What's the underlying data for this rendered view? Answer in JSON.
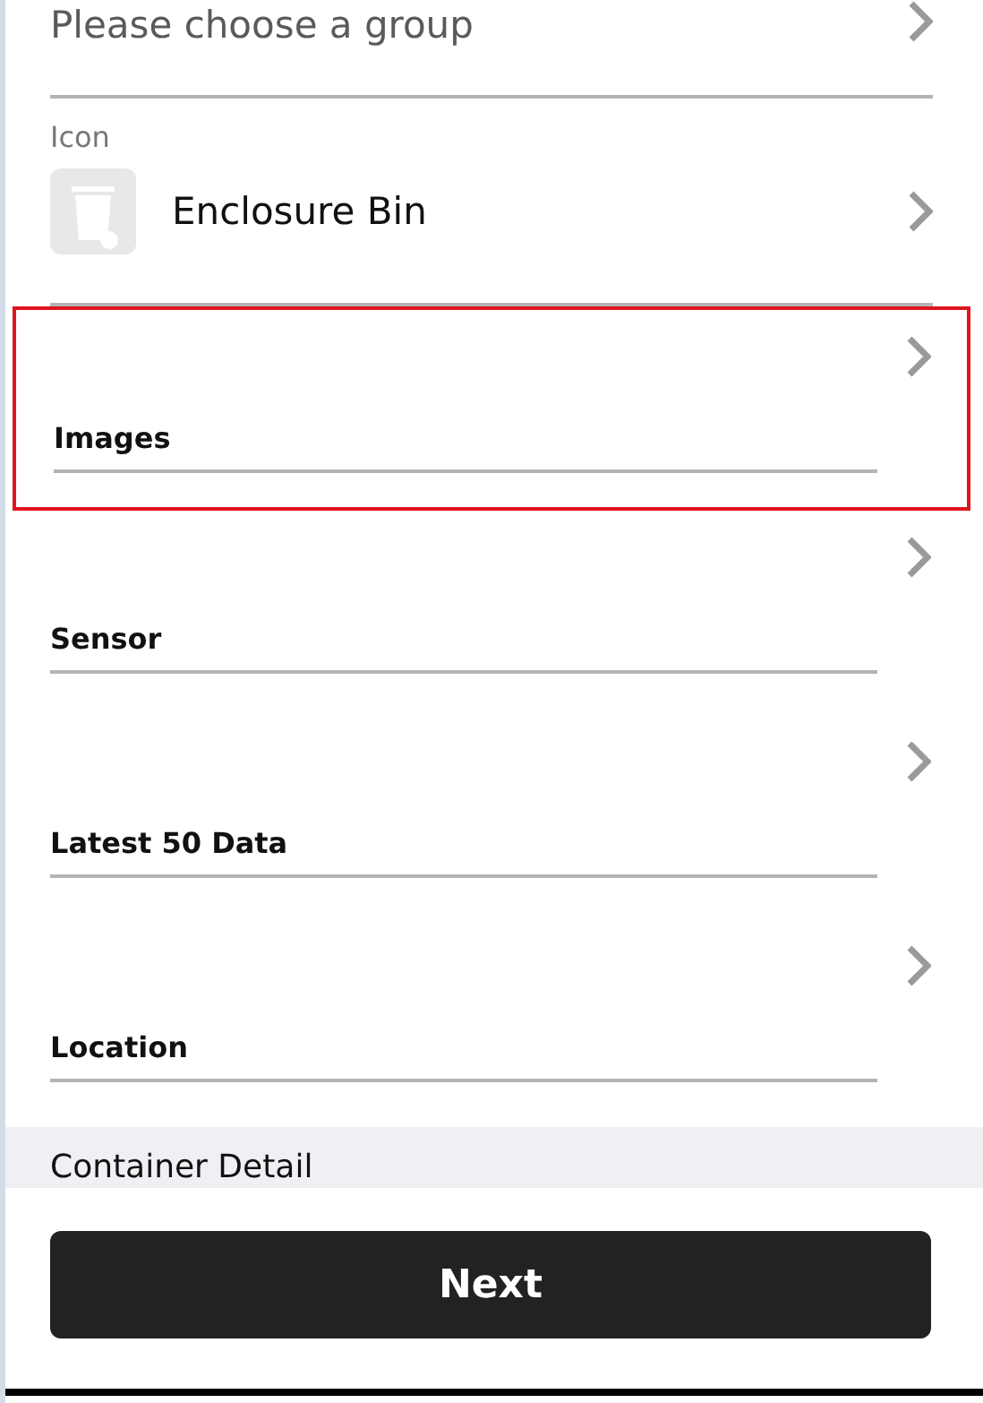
{
  "group_select": {
    "placeholder": "Please choose a group"
  },
  "icon_field": {
    "label": "Icon",
    "value": "Enclosure Bin"
  },
  "links": [
    {
      "label": "Images",
      "highlighted": true
    },
    {
      "label": "Sensor",
      "highlighted": false
    },
    {
      "label": "Latest 50 Data",
      "highlighted": false
    },
    {
      "label": "Location",
      "highlighted": false
    }
  ],
  "section": {
    "title": "Container Detail"
  },
  "next_button": {
    "label": "Next"
  }
}
